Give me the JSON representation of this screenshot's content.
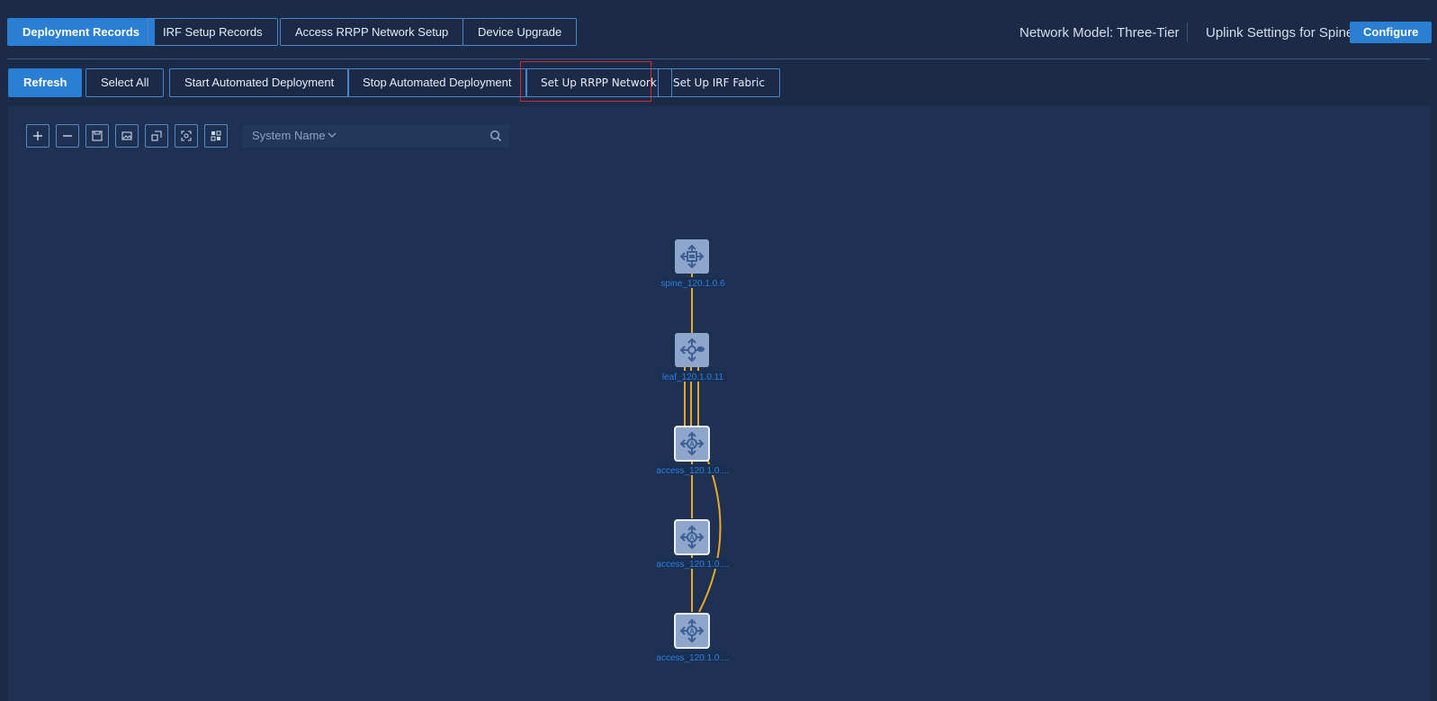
{
  "header": {
    "tabs": [
      {
        "label": "Deployment Records",
        "active": true
      },
      {
        "label": "IRF Setup Records",
        "active": false
      },
      {
        "label": "Access RRPP Network Setup",
        "active": false
      },
      {
        "label": "Device Upgrade",
        "active": false
      }
    ],
    "network_model": "Network Model: Three-Tier",
    "uplink_label": "Uplink Settings for Spine:",
    "configure_label": "Configure"
  },
  "toolbar": {
    "refresh_label": "Refresh",
    "select_all_label": "Select All",
    "start_label": "Start Automated Deployment",
    "stop_label": "Stop Automated Deployment",
    "rrpp_label": "Set Up RRPP Network",
    "irf_label": "Set Up IRF Fabric"
  },
  "topology_tools": {
    "icons": [
      "zoom-in-icon",
      "zoom-out-icon",
      "save-icon",
      "export-image-icon",
      "fit-view-icon",
      "fullscreen-icon",
      "layout-icon"
    ],
    "search_field": "System Name",
    "search_value": ""
  },
  "topology": {
    "link_color": "#e8a825",
    "nodes": [
      {
        "name": "spine",
        "label": "spine_120.1.0.6"
      },
      {
        "name": "leaf",
        "label": "leaf_120.1.0.11"
      },
      {
        "name": "access-1",
        "label": "access_120.1.0...."
      },
      {
        "name": "access-2",
        "label": "access_120.1.0...."
      },
      {
        "name": "access-3",
        "label": "access_120.1.0...."
      }
    ]
  },
  "colors": {
    "accent": "#2a7fd4",
    "background": "#1a2a47",
    "highlight_border": "#d6262e"
  }
}
